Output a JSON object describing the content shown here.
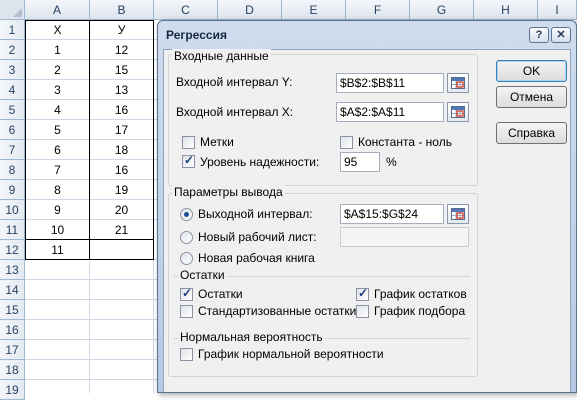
{
  "sheet": {
    "columns": [
      "A",
      "B",
      "C",
      "D",
      "E",
      "F",
      "G",
      "H",
      "I"
    ],
    "rows": [
      "1",
      "2",
      "3",
      "4",
      "5",
      "6",
      "7",
      "8",
      "9",
      "10",
      "11",
      "12",
      "13",
      "14",
      "15",
      "16",
      "17",
      "18",
      "19"
    ],
    "headers": {
      "x": "X",
      "y": "У"
    },
    "x_values": [
      "1",
      "2",
      "3",
      "4",
      "5",
      "6",
      "7",
      "8",
      "9",
      "10",
      "11"
    ],
    "y_values": [
      "12",
      "15",
      "13",
      "16",
      "17",
      "18",
      "16",
      "19",
      "20",
      "21"
    ]
  },
  "dialog": {
    "title": "Регрессия",
    "help_glyph": "?",
    "close_glyph": "✕",
    "input_group": "Входные данные",
    "input_y_label": "Входной интервал Y:",
    "input_y_value": "$B$2:$B$11",
    "input_x_label": "Входной интервал X:",
    "input_x_value": "$A$2:$A$11",
    "labels_checkbox": "Метки",
    "labels_checked": false,
    "constant_zero_checkbox": "Константа - ноль",
    "constant_zero_checked": false,
    "confidence_checkbox": "Уровень надежности:",
    "confidence_checked": true,
    "confidence_value": "95",
    "percent_sign": "%",
    "output_group": "Параметры вывода",
    "output_range_label": "Выходной интервал:",
    "output_range_value": "$A$15:$G$24",
    "output_range_selected": true,
    "new_sheet_label": "Новый рабочий лист:",
    "new_sheet_value": "",
    "new_workbook_label": "Новая рабочая книга",
    "residuals_group": "Остатки",
    "residuals_checkbox": "Остатки",
    "residuals_checked": true,
    "std_residuals_checkbox": "Стандартизованные остатки",
    "std_residuals_checked": false,
    "residual_plot_checkbox": "График остатков",
    "residual_plot_checked": true,
    "line_fit_checkbox": "График подбора",
    "line_fit_checked": false,
    "normal_group": "Нормальная вероятность",
    "normal_plot_checkbox": "График нормальной вероятности",
    "normal_plot_checked": false,
    "ok_button": "OK",
    "cancel_button": "Отмена",
    "help_button": "Справка"
  }
}
